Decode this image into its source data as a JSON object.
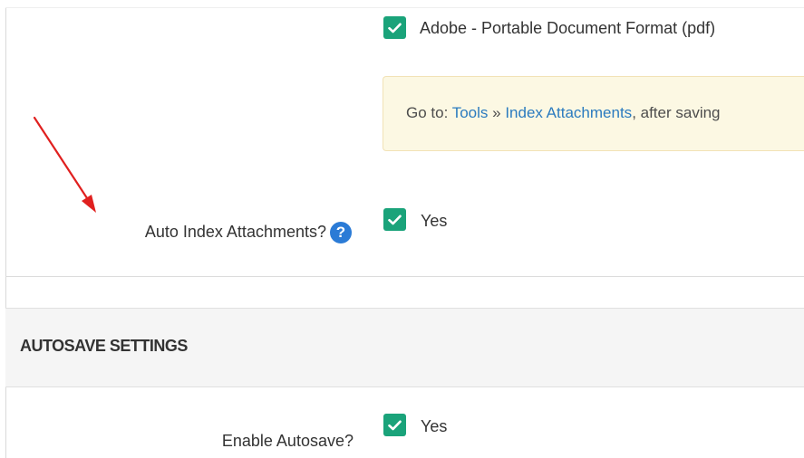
{
  "file_types": {
    "pdf_label": "Adobe - Portable Document Format (pdf)"
  },
  "notice": {
    "prefix": "Go to: ",
    "link_tools": "Tools",
    "separator": " » ",
    "link_index": "Index Attachments",
    "suffix": ", after saving"
  },
  "auto_index": {
    "label": "Auto Index Attachments?",
    "value_label": "Yes",
    "help_glyph": "?"
  },
  "autosave_section": {
    "title": "AUTOSAVE SETTINGS"
  },
  "enable_autosave": {
    "label": "Enable Autosave?",
    "value_label": "Yes"
  },
  "colors": {
    "checkbox": "#1aa37a",
    "link": "#2b7bbf",
    "notice_bg": "#fcf8e3",
    "help_icon": "#2b7bd6",
    "annotation_arrow": "#e0201f"
  },
  "icons": {
    "checkbox_mark": "checkmark-icon",
    "help": "question-circle-icon",
    "annotation": "red-arrow-icon"
  }
}
